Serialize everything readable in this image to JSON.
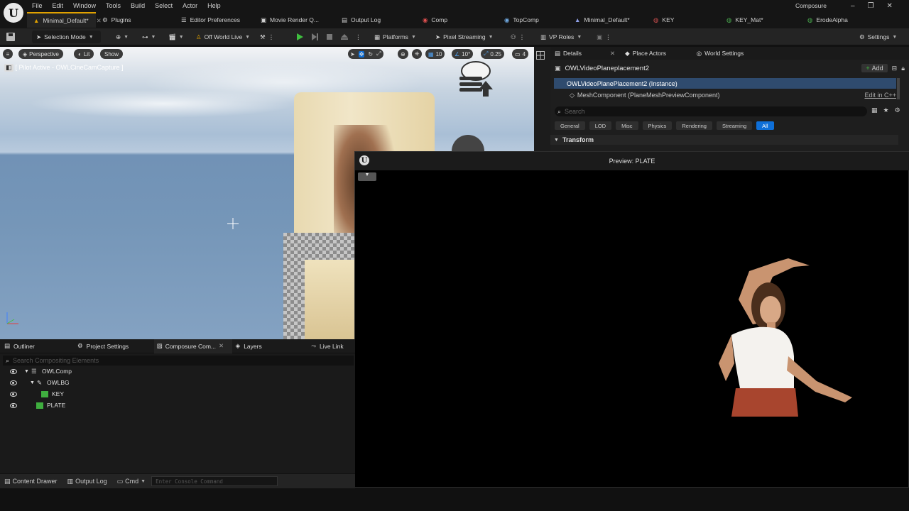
{
  "menu": [
    "File",
    "Edit",
    "Window",
    "Tools",
    "Build",
    "Select",
    "Actor",
    "Help"
  ],
  "app_label": "Composure",
  "tabs": [
    {
      "label": "Minimal_Default*",
      "active": true,
      "icon": "level-icon"
    },
    {
      "label": "Plugins",
      "icon": "plugin-icon"
    },
    {
      "label": "Editor Preferences",
      "icon": "sliders-icon"
    },
    {
      "label": "Movie Render Q...",
      "icon": "movie-icon"
    },
    {
      "label": "Output Log",
      "icon": "log-icon"
    },
    {
      "label": "Comp",
      "icon": "comp-icon"
    },
    {
      "label": "TopComp",
      "icon": "comp-icon"
    },
    {
      "label": "Minimal_Default*",
      "icon": "level-icon"
    },
    {
      "label": "KEY",
      "icon": "material-icon"
    },
    {
      "label": "KEY_Mat*",
      "icon": "material-icon"
    },
    {
      "label": "ErodeAlpha",
      "icon": "material-icon"
    }
  ],
  "toolbar": {
    "selection_mode": "Selection Mode",
    "world": "Off World Live",
    "platforms": "Platforms",
    "pixel_streaming": "Pixel Streaming",
    "vp_roles": "VP Roles",
    "settings": "Settings"
  },
  "viewport": {
    "perspective": "Perspective",
    "lit": "Lit",
    "show": "Show",
    "pilot": "[ Pilot Active - OWLCineCamCapture ]",
    "grid_size": "10",
    "rotation_snap": "10°",
    "scale_snap": "0.25",
    "camera_speed": "4"
  },
  "details": {
    "tabs": [
      "Details",
      "Place Actors",
      "World Settings"
    ],
    "actor_name": "OWLVideoPlaneplacement2",
    "add_label": "Add",
    "instance_label": "OWLVideoPlanePlacement2 (Instance)",
    "component_label": "MeshComponent (PlaneMeshPreviewComponent)",
    "edit_cpp": "Edit in C++",
    "search_placeholder": "Search",
    "filters": [
      "General",
      "LOD",
      "Misc",
      "Physics",
      "Rendering",
      "Streaming",
      "All"
    ],
    "active_filter": "All",
    "section": "Transform"
  },
  "preview": {
    "title": "Preview: PLATE"
  },
  "lower_tabs": [
    "Outliner",
    "Project Settings",
    "Composure Com...",
    "Layers",
    "Live Link"
  ],
  "compositing": {
    "search_placeholder": "Search Compositing Elements",
    "tree": [
      {
        "label": "OWLComp",
        "depth": 0,
        "icon": "comp-stack-icon"
      },
      {
        "label": "OWLBG",
        "depth": 1,
        "icon": "layer-icon"
      },
      {
        "label": "KEY",
        "depth": 2,
        "icon": "element-icon"
      },
      {
        "label": "PLATE",
        "depth": 1,
        "icon": "element-icon"
      }
    ]
  },
  "statusbar": {
    "content_drawer": "Content Drawer",
    "output_log": "Output Log",
    "cmd": "Cmd",
    "console_placeholder": "Enter Console Command"
  },
  "colors": {
    "accent_orange": "#e0a100",
    "accent_blue": "#0e6fd8",
    "play_green": "#3fbf3f",
    "selected_row": "#2f4b6e"
  }
}
